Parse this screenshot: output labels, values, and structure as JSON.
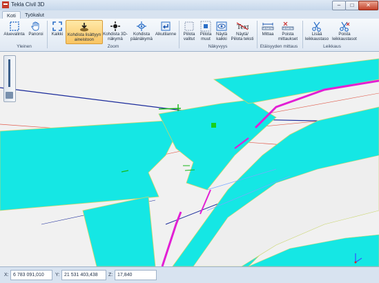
{
  "window": {
    "title": "Tekla Civil 3D",
    "minimize": "–",
    "maximize": "□",
    "close": "✕"
  },
  "tabs": [
    {
      "label": "Koti"
    },
    {
      "label": "Työkalut"
    }
  ],
  "ribbon": {
    "groups": {
      "yleinen": "Yleinen",
      "zoom": "Zoom",
      "nakyvyys": "Näkyvyys",
      "etaisyyden_mittaus": "Etäisyyden mittaus",
      "leikkaus": "Leikkaus"
    },
    "buttons": {
      "aluevalinta": "Aluevalinta",
      "panoroi": "Panoroi",
      "kaikki": "Kaikki",
      "kohdista_lisattyyn": "Kohdista lisättyyn aineistoon",
      "kohdista_3d": "Kohdista 3D-näkymä",
      "kohdista_paanakyma": "Kohdista päänäkymä",
      "alkutilanne": "Alkutilanne",
      "piilota_valitut": "Piilota valitut",
      "piilota_muut": "Piilota muut",
      "nayta_kaikki": "Näytä kaikki",
      "nayta_piilota_teksti": "Näytä/ Piilota teksti",
      "mittaa": "Mittaa",
      "poista_mittaukset": "Poista mittaukset",
      "lisaa_leikkaustaso": "Lisää leikkaustaso",
      "poista_leikkaustasot": "Poista leikkaustasot"
    },
    "text_icon": "Text"
  },
  "statusbar": {
    "x_label": "X:",
    "x_value": "6 783 091,010",
    "y_label": "Y:",
    "y_value": "21 531 403,438",
    "z_label": "Z:",
    "z_value": "17,840"
  }
}
